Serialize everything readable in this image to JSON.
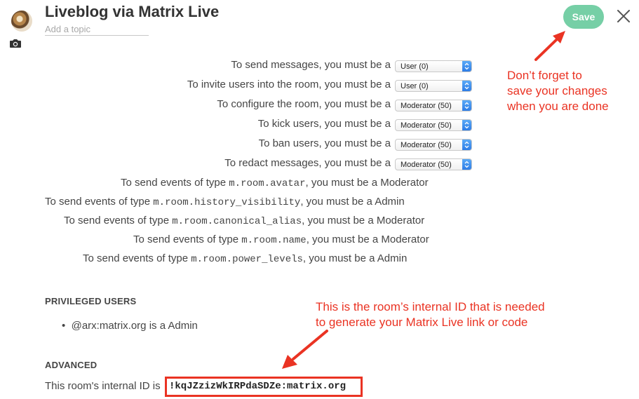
{
  "header": {
    "room_name": "Liveblog via Matrix Live",
    "topic_placeholder": "Add a topic",
    "save_label": "Save",
    "avatar_icon": "room-avatar-icon",
    "camera_icon": "camera-icon",
    "close_icon": "close-icon"
  },
  "power_levels": [
    {
      "label": "To send messages, you must be a",
      "value": "User (0)"
    },
    {
      "label": "To invite users into the room, you must be a",
      "value": "User (0)"
    },
    {
      "label": "To configure the room, you must be a",
      "value": "Moderator (50)"
    },
    {
      "label": "To kick users, you must be a",
      "value": "Moderator (50)"
    },
    {
      "label": "To ban users, you must be a",
      "value": "Moderator (50)"
    },
    {
      "label": "To redact messages, you must be a",
      "value": "Moderator (50)"
    }
  ],
  "event_types": [
    {
      "prefix": "To send events of type ",
      "type": "m.room.avatar",
      "suffix": ", you must be a Moderator"
    },
    {
      "prefix": "To send events of type ",
      "type": "m.room.history_visibility",
      "suffix": ", you must be a Admin"
    },
    {
      "prefix": "To send events of type ",
      "type": "m.room.canonical_alias",
      "suffix": ", you must be a Moderator"
    },
    {
      "prefix": "To send events of type ",
      "type": "m.room.name",
      "suffix": ", you must be a Moderator"
    },
    {
      "prefix": "To send events of type ",
      "type": "m.room.power_levels",
      "suffix": ", you must be a Admin"
    }
  ],
  "privileged_users": {
    "title": "PRIVILEGED USERS",
    "items": [
      "@arx:matrix.org is a Admin"
    ]
  },
  "advanced": {
    "title": "ADVANCED",
    "id_label": "This room's internal ID is",
    "room_id": "!kqJZzizWkIRPdaSDZe:matrix.org"
  },
  "annotations": {
    "save_note": [
      "Don’t forget to",
      "save your changes",
      "when you are done"
    ],
    "id_note": [
      "This is the room’s internal ID that is needed",
      "to generate your Matrix Live link or code"
    ],
    "color": "#ea3323"
  },
  "colors": {
    "save_button": "#76cfa6",
    "select_arrow": "#2d7ce6",
    "text": "#454545"
  }
}
